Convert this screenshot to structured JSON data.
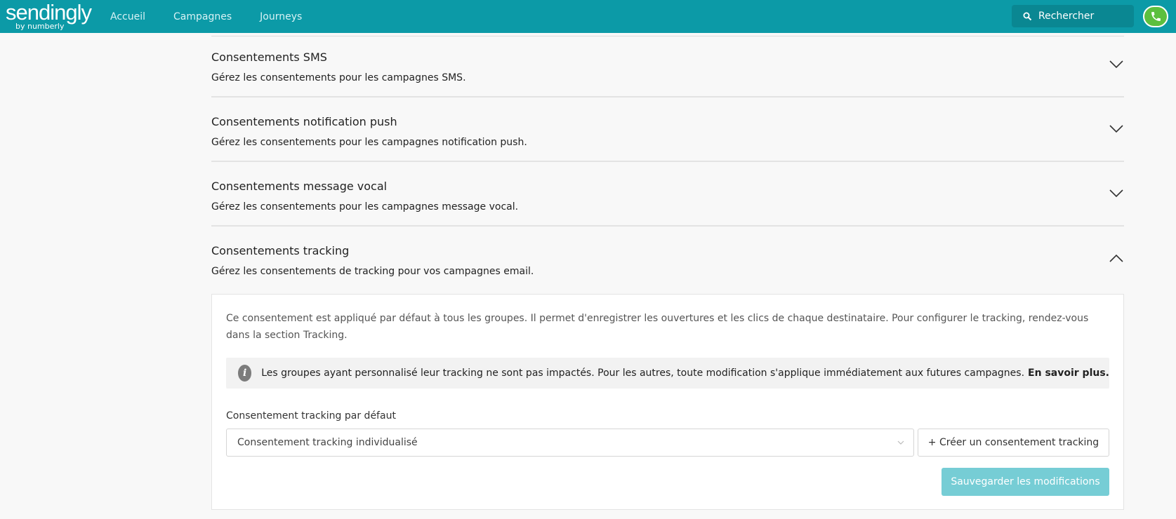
{
  "brand": {
    "name": "sendingly",
    "sub": "by numberly"
  },
  "nav": {
    "items": [
      "Accueil",
      "Campagnes",
      "Journeys"
    ]
  },
  "search": {
    "placeholder": "Rechercher"
  },
  "accordion": [
    {
      "title": "Consentements SMS",
      "desc": "Gérez les consentements pour les campagnes SMS."
    },
    {
      "title": "Consentements notification push",
      "desc": "Gérez les consentements pour les campagnes notification push."
    },
    {
      "title": "Consentements message vocal",
      "desc": "Gérez les consentements pour les campagnes message vocal."
    },
    {
      "title": "Consentements tracking",
      "desc": "Gérez les consentements de tracking pour vos campagnes email."
    }
  ],
  "tracking_panel": {
    "text": "Ce consentement est appliqué par défaut à tous les groupes. Il permet d'enregistrer les ouvertures et les clics de chaque destinataire. Pour configurer le tracking, rendez-vous dans la section Tracking.",
    "info": "Les groupes ayant personnalisé leur tracking ne sont pas impactés. Pour les autres, toute modification s'applique immédiatement aux futures campagnes.",
    "info_link": "En savoir plus.",
    "field_label": "Consentement tracking par défaut",
    "select_value": "Consentement tracking individualisé",
    "create_button": "+ Créer un consentement tracking",
    "save_button": "Sauvegarder les modifications"
  },
  "colors": {
    "topbar": "#0c9aa7",
    "primary_button": "#76cdd5",
    "phone": "#5cbf3e"
  }
}
